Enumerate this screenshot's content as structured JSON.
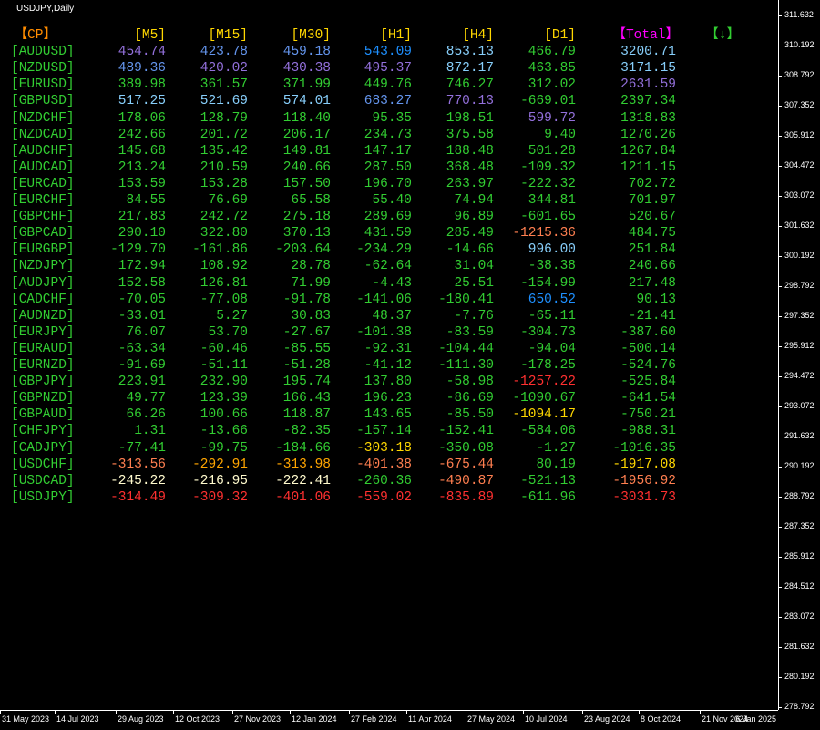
{
  "window": {
    "title": "USDJPY,Daily"
  },
  "headers": [
    {
      "label": "【CP】",
      "color": "#FF8C00"
    },
    {
      "label": "[M5]",
      "color": "#FFD700"
    },
    {
      "label": "[M15]",
      "color": "#FFD700"
    },
    {
      "label": "[M30]",
      "color": "#FFD700"
    },
    {
      "label": "[H1]",
      "color": "#FFD700"
    },
    {
      "label": "[H4]",
      "color": "#FFD700"
    },
    {
      "label": "[D1]",
      "color": "#FFD700"
    },
    {
      "label": "【Total】",
      "color": "#FF00FF"
    },
    {
      "label": "【↓】",
      "color": "#32CD32"
    }
  ],
  "rows": [
    {
      "pair": "[AUDUSD]",
      "cells": [
        [
          "454.74",
          "#9370DB"
        ],
        [
          "423.78",
          "#6495ED"
        ],
        [
          "459.18",
          "#6495ED"
        ],
        [
          "543.09",
          "#1E90FF"
        ],
        [
          "853.13",
          "#87CEFA"
        ],
        [
          "466.79",
          "#32CD32"
        ],
        [
          "3200.71",
          "#87CEFA"
        ]
      ]
    },
    {
      "pair": "[NZDUSD]",
      "cells": [
        [
          "489.36",
          "#6495ED"
        ],
        [
          "420.02",
          "#9370DB"
        ],
        [
          "430.38",
          "#9370DB"
        ],
        [
          "495.37",
          "#9370DB"
        ],
        [
          "872.17",
          "#87CEFA"
        ],
        [
          "463.85",
          "#32CD32"
        ],
        [
          "3171.15",
          "#87CEFA"
        ]
      ]
    },
    {
      "pair": "[EURUSD]",
      "cells": [
        [
          "389.98",
          "#32CD32"
        ],
        [
          "361.57",
          "#32CD32"
        ],
        [
          "371.99",
          "#32CD32"
        ],
        [
          "449.76",
          "#32CD32"
        ],
        [
          "746.27",
          "#32CD32"
        ],
        [
          "312.02",
          "#32CD32"
        ],
        [
          "2631.59",
          "#9370DB"
        ]
      ]
    },
    {
      "pair": "[GBPUSD]",
      "cells": [
        [
          "517.25",
          "#87CEFA"
        ],
        [
          "521.69",
          "#87CEFA"
        ],
        [
          "574.01",
          "#87CEFA"
        ],
        [
          "683.27",
          "#6495ED"
        ],
        [
          "770.13",
          "#9370DB"
        ],
        [
          "-669.01",
          "#32CD32"
        ],
        [
          "2397.34",
          "#32CD32"
        ]
      ]
    },
    {
      "pair": "[NZDCHF]",
      "cells": [
        [
          "178.06",
          "#32CD32"
        ],
        [
          "128.79",
          "#32CD32"
        ],
        [
          "118.40",
          "#32CD32"
        ],
        [
          "95.35",
          "#32CD32"
        ],
        [
          "198.51",
          "#32CD32"
        ],
        [
          "599.72",
          "#9370DB"
        ],
        [
          "1318.83",
          "#32CD32"
        ]
      ]
    },
    {
      "pair": "[NZDCAD]",
      "cells": [
        [
          "242.66",
          "#32CD32"
        ],
        [
          "201.72",
          "#32CD32"
        ],
        [
          "206.17",
          "#32CD32"
        ],
        [
          "234.73",
          "#32CD32"
        ],
        [
          "375.58",
          "#32CD32"
        ],
        [
          "9.40",
          "#32CD32"
        ],
        [
          "1270.26",
          "#32CD32"
        ]
      ]
    },
    {
      "pair": "[AUDCHF]",
      "cells": [
        [
          "145.68",
          "#32CD32"
        ],
        [
          "135.42",
          "#32CD32"
        ],
        [
          "149.81",
          "#32CD32"
        ],
        [
          "147.17",
          "#32CD32"
        ],
        [
          "188.48",
          "#32CD32"
        ],
        [
          "501.28",
          "#32CD32"
        ],
        [
          "1267.84",
          "#32CD32"
        ]
      ]
    },
    {
      "pair": "[AUDCAD]",
      "cells": [
        [
          "213.24",
          "#32CD32"
        ],
        [
          "210.59",
          "#32CD32"
        ],
        [
          "240.66",
          "#32CD32"
        ],
        [
          "287.50",
          "#32CD32"
        ],
        [
          "368.48",
          "#32CD32"
        ],
        [
          "-109.32",
          "#32CD32"
        ],
        [
          "1211.15",
          "#32CD32"
        ]
      ]
    },
    {
      "pair": "[EURCAD]",
      "cells": [
        [
          "153.59",
          "#32CD32"
        ],
        [
          "153.28",
          "#32CD32"
        ],
        [
          "157.50",
          "#32CD32"
        ],
        [
          "196.70",
          "#32CD32"
        ],
        [
          "263.97",
          "#32CD32"
        ],
        [
          "-222.32",
          "#32CD32"
        ],
        [
          "702.72",
          "#32CD32"
        ]
      ]
    },
    {
      "pair": "[EURCHF]",
      "cells": [
        [
          "84.55",
          "#32CD32"
        ],
        [
          "76.69",
          "#32CD32"
        ],
        [
          "65.58",
          "#32CD32"
        ],
        [
          "55.40",
          "#32CD32"
        ],
        [
          "74.94",
          "#32CD32"
        ],
        [
          "344.81",
          "#32CD32"
        ],
        [
          "701.97",
          "#32CD32"
        ]
      ]
    },
    {
      "pair": "[GBPCHF]",
      "cells": [
        [
          "217.83",
          "#32CD32"
        ],
        [
          "242.72",
          "#32CD32"
        ],
        [
          "275.18",
          "#32CD32"
        ],
        [
          "289.69",
          "#32CD32"
        ],
        [
          "96.89",
          "#32CD32"
        ],
        [
          "-601.65",
          "#32CD32"
        ],
        [
          "520.67",
          "#32CD32"
        ]
      ]
    },
    {
      "pair": "[GBPCAD]",
      "cells": [
        [
          "290.10",
          "#32CD32"
        ],
        [
          "322.80",
          "#32CD32"
        ],
        [
          "370.13",
          "#32CD32"
        ],
        [
          "431.59",
          "#32CD32"
        ],
        [
          "285.49",
          "#32CD32"
        ],
        [
          "-1215.36",
          "#FF7F50"
        ],
        [
          "484.75",
          "#32CD32"
        ]
      ]
    },
    {
      "pair": "[EURGBP]",
      "cells": [
        [
          "-129.70",
          "#32CD32"
        ],
        [
          "-161.86",
          "#32CD32"
        ],
        [
          "-203.64",
          "#32CD32"
        ],
        [
          "-234.29",
          "#32CD32"
        ],
        [
          "-14.66",
          "#32CD32"
        ],
        [
          "996.00",
          "#87CEFA"
        ],
        [
          "251.84",
          "#32CD32"
        ]
      ]
    },
    {
      "pair": "[NZDJPY]",
      "cells": [
        [
          "172.94",
          "#32CD32"
        ],
        [
          "108.92",
          "#32CD32"
        ],
        [
          "28.78",
          "#32CD32"
        ],
        [
          "-62.64",
          "#32CD32"
        ],
        [
          "31.04",
          "#32CD32"
        ],
        [
          "-38.38",
          "#32CD32"
        ],
        [
          "240.66",
          "#32CD32"
        ]
      ]
    },
    {
      "pair": "[AUDJPY]",
      "cells": [
        [
          "152.58",
          "#32CD32"
        ],
        [
          "126.81",
          "#32CD32"
        ],
        [
          "71.99",
          "#32CD32"
        ],
        [
          "-4.43",
          "#32CD32"
        ],
        [
          "25.51",
          "#32CD32"
        ],
        [
          "-154.99",
          "#32CD32"
        ],
        [
          "217.48",
          "#32CD32"
        ]
      ]
    },
    {
      "pair": "[CADCHF]",
      "cells": [
        [
          "-70.05",
          "#32CD32"
        ],
        [
          "-77.08",
          "#32CD32"
        ],
        [
          "-91.78",
          "#32CD32"
        ],
        [
          "-141.06",
          "#32CD32"
        ],
        [
          "-180.41",
          "#32CD32"
        ],
        [
          "650.52",
          "#1E90FF"
        ],
        [
          "90.13",
          "#32CD32"
        ]
      ]
    },
    {
      "pair": "[AUDNZD]",
      "cells": [
        [
          "-33.01",
          "#32CD32"
        ],
        [
          "5.27",
          "#32CD32"
        ],
        [
          "30.83",
          "#32CD32"
        ],
        [
          "48.37",
          "#32CD32"
        ],
        [
          "-7.76",
          "#32CD32"
        ],
        [
          "-65.11",
          "#32CD32"
        ],
        [
          "-21.41",
          "#32CD32"
        ]
      ]
    },
    {
      "pair": "[EURJPY]",
      "cells": [
        [
          "76.07",
          "#32CD32"
        ],
        [
          "53.70",
          "#32CD32"
        ],
        [
          "-27.67",
          "#32CD32"
        ],
        [
          "-101.38",
          "#32CD32"
        ],
        [
          "-83.59",
          "#32CD32"
        ],
        [
          "-304.73",
          "#32CD32"
        ],
        [
          "-387.60",
          "#32CD32"
        ]
      ]
    },
    {
      "pair": "[EURAUD]",
      "cells": [
        [
          "-63.34",
          "#32CD32"
        ],
        [
          "-60.46",
          "#32CD32"
        ],
        [
          "-85.55",
          "#32CD32"
        ],
        [
          "-92.31",
          "#32CD32"
        ],
        [
          "-104.44",
          "#32CD32"
        ],
        [
          "-94.04",
          "#32CD32"
        ],
        [
          "-500.14",
          "#32CD32"
        ]
      ]
    },
    {
      "pair": "[EURNZD]",
      "cells": [
        [
          "-91.69",
          "#32CD32"
        ],
        [
          "-51.11",
          "#32CD32"
        ],
        [
          "-51.28",
          "#32CD32"
        ],
        [
          "-41.12",
          "#32CD32"
        ],
        [
          "-111.30",
          "#32CD32"
        ],
        [
          "-178.25",
          "#32CD32"
        ],
        [
          "-524.76",
          "#32CD32"
        ]
      ]
    },
    {
      "pair": "[GBPJPY]",
      "cells": [
        [
          "223.91",
          "#32CD32"
        ],
        [
          "232.90",
          "#32CD32"
        ],
        [
          "195.74",
          "#32CD32"
        ],
        [
          "137.80",
          "#32CD32"
        ],
        [
          "-58.98",
          "#32CD32"
        ],
        [
          "-1257.22",
          "#FF3030"
        ],
        [
          "-525.84",
          "#32CD32"
        ]
      ]
    },
    {
      "pair": "[GBPNZD]",
      "cells": [
        [
          "49.77",
          "#32CD32"
        ],
        [
          "123.39",
          "#32CD32"
        ],
        [
          "166.43",
          "#32CD32"
        ],
        [
          "196.23",
          "#32CD32"
        ],
        [
          "-86.69",
          "#32CD32"
        ],
        [
          "-1090.67",
          "#32CD32"
        ],
        [
          "-641.54",
          "#32CD32"
        ]
      ]
    },
    {
      "pair": "[GBPAUD]",
      "cells": [
        [
          "66.26",
          "#32CD32"
        ],
        [
          "100.66",
          "#32CD32"
        ],
        [
          "118.87",
          "#32CD32"
        ],
        [
          "143.65",
          "#32CD32"
        ],
        [
          "-85.50",
          "#32CD32"
        ],
        [
          "-1094.17",
          "#FFD700"
        ],
        [
          "-750.21",
          "#32CD32"
        ]
      ]
    },
    {
      "pair": "[CHFJPY]",
      "cells": [
        [
          "1.31",
          "#32CD32"
        ],
        [
          "-13.66",
          "#32CD32"
        ],
        [
          "-82.35",
          "#32CD32"
        ],
        [
          "-157.14",
          "#32CD32"
        ],
        [
          "-152.41",
          "#32CD32"
        ],
        [
          "-584.06",
          "#32CD32"
        ],
        [
          "-988.31",
          "#32CD32"
        ]
      ]
    },
    {
      "pair": "[CADJPY]",
      "cells": [
        [
          "-77.41",
          "#32CD32"
        ],
        [
          "-99.75",
          "#32CD32"
        ],
        [
          "-184.66",
          "#32CD32"
        ],
        [
          "-303.18",
          "#FFD700"
        ],
        [
          "-350.08",
          "#32CD32"
        ],
        [
          "-1.27",
          "#32CD32"
        ],
        [
          "-1016.35",
          "#32CD32"
        ]
      ]
    },
    {
      "pair": "[USDCHF]",
      "cells": [
        [
          "-313.56",
          "#FF7F50"
        ],
        [
          "-292.91",
          "#FFA500"
        ],
        [
          "-313.98",
          "#FFA500"
        ],
        [
          "-401.38",
          "#FF7F50"
        ],
        [
          "-675.44",
          "#FF7F50"
        ],
        [
          "80.19",
          "#32CD32"
        ],
        [
          "-1917.08",
          "#FFD700"
        ]
      ]
    },
    {
      "pair": "[USDCAD]",
      "cells": [
        [
          "-245.22",
          "#FFFACD"
        ],
        [
          "-216.95",
          "#FFFACD"
        ],
        [
          "-222.41",
          "#FFFACD"
        ],
        [
          "-260.36",
          "#32CD32"
        ],
        [
          "-490.87",
          "#FF7F50"
        ],
        [
          "-521.13",
          "#32CD32"
        ],
        [
          "-1956.92",
          "#FF7F50"
        ]
      ]
    },
    {
      "pair": "[USDJPY]",
      "cells": [
        [
          "-314.49",
          "#FF3030"
        ],
        [
          "-309.32",
          "#FF3030"
        ],
        [
          "-401.06",
          "#FF3030"
        ],
        [
          "-559.02",
          "#FF3030"
        ],
        [
          "-835.89",
          "#FF3030"
        ],
        [
          "-611.96",
          "#32CD32"
        ],
        [
          "-3031.73",
          "#FF3030"
        ]
      ]
    }
  ],
  "pair_color": "#32CD32",
  "price_axis": [
    "311.632",
    "310.192",
    "308.792",
    "307.352",
    "305.912",
    "304.472",
    "303.072",
    "301.632",
    "300.192",
    "298.792",
    "297.352",
    "295.912",
    "294.472",
    "293.072",
    "291.632",
    "290.192",
    "288.792",
    "287.352",
    "285.912",
    "284.512",
    "283.072",
    "281.632",
    "280.192",
    "278.792"
  ],
  "time_axis": [
    "31 May 2023",
    "14 Jul 2023",
    "29 Aug 2023",
    "12 Oct 2023",
    "27 Nov 2023",
    "12 Jan 2024",
    "27 Feb 2024",
    "11 Apr 2024",
    "27 May 2024",
    "10 Jul 2024",
    "23 Aug 2024",
    "8 Oct 2024",
    "21 Nov 2024",
    "6 Jan 2025"
  ]
}
